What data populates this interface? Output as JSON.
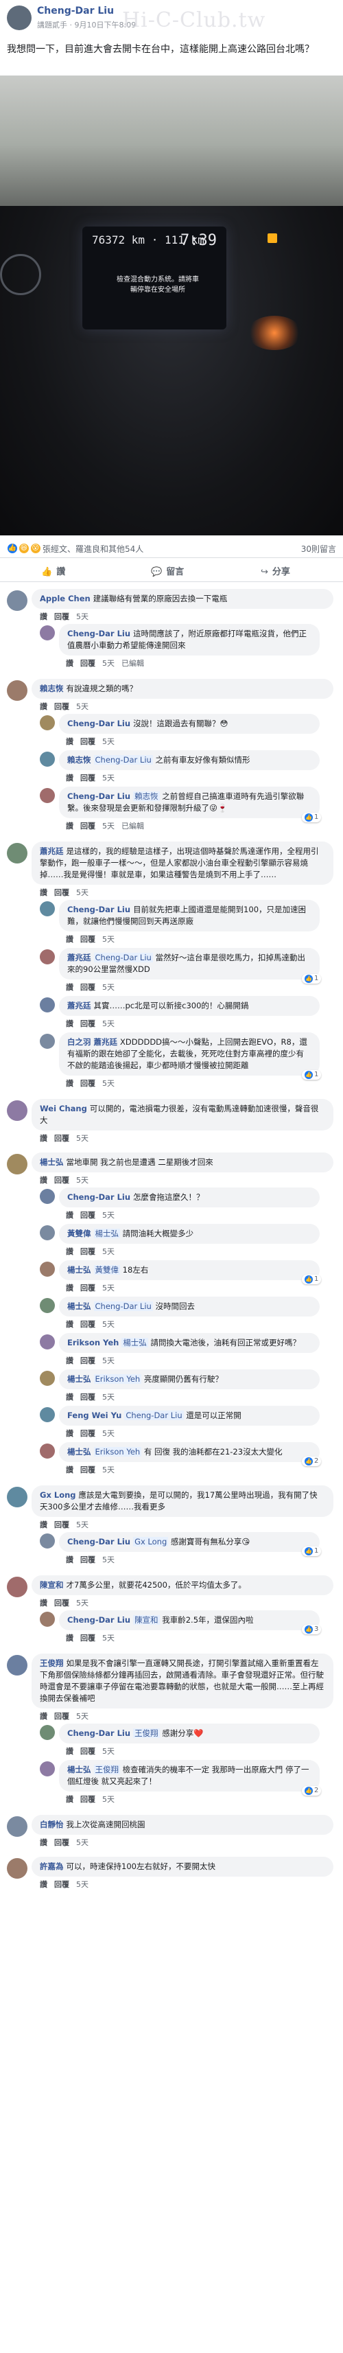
{
  "post": {
    "author": "Cheng-Dar Liu",
    "meta": "講題貳手 · 9月10日下午8:09",
    "watermark": "Hi-C-Club.tw",
    "text": "我想問一下，目前進大會去開卡在台中，這樣能開上高速公路回台北嗎？",
    "photo": {
      "odometer": "76372 km · 111 km",
      "clock": "7:39",
      "warning": "檢查混合動力系統。請將車輛停靠在安全場所"
    }
  },
  "reactions": {
    "summary": "張經文、羅進良和其他54人",
    "comments": "30則留言"
  },
  "actions": {
    "like": "讚",
    "comment": "留言",
    "share": "分享"
  },
  "comments": [
    {
      "name": "Apple Chen",
      "text": "建議聯絡有營業的原廠因去換一下電瓶",
      "links": [
        "讚",
        "回覆",
        "5天"
      ],
      "replies": [
        {
          "name": "Cheng-Dar Liu",
          "text": "這時間應該了，附近原廠都打咩電瓶沒貨，他們正值農曆小車動力希望能傳達開回來",
          "links": [
            "讚",
            "回覆",
            "5天",
            "已編輯"
          ]
        }
      ]
    },
    {
      "name": "賴志恢",
      "text": "有說違規之類的嗎？",
      "links": [
        "讚",
        "回覆",
        "5天"
      ],
      "replies": [
        {
          "name": "Cheng-Dar Liu",
          "text": "沒說！這跟過去有關聯？😳",
          "links": [
            "讚",
            "回覆",
            "5天"
          ]
        },
        {
          "name": "賴志恢",
          "tag": "Cheng-Dar Liu",
          "text": "之前有車友好像有類似情形",
          "links": [
            "讚",
            "回覆",
            "5天"
          ]
        },
        {
          "name": "Cheng-Dar Liu",
          "tag": "賴志恢",
          "text": "之前曾經自己搞進車道時有先過引擎欲聯繫。後來發現是会更新和發揮限制升級了😜🍷",
          "links": [
            "讚",
            "回覆",
            "5天",
            "已編輯"
          ],
          "badge": "1"
        }
      ]
    },
    {
      "name": "蕭兆廷",
      "text": "是這樣的，我的經驗是這樣子，出現這個時基聲於馬達運作用，全程用引擎動作，跑一般車子一樣～～，但是人家都說小油台車全程動引擎顯示容易燒掉……我是覺得慢！車就是車，如果這種警告是燒到不用上手了……",
      "links": [
        "讚",
        "回覆",
        "5天"
      ],
      "replies": [
        {
          "name": "Cheng-Dar Liu",
          "text": "目前就先把車上國道還是能開到100，只是加速困難，就讓他們慢慢開回到天再送原廠",
          "links": [
            "讚",
            "回覆",
            "5天"
          ]
        },
        {
          "name": "蕭兆廷",
          "tag": "Cheng-Dar Liu",
          "text": "當然好～這台車是很吃馬力，扣掉馬達動出來的90公里當然慢XDD",
          "links": [
            "讚",
            "回覆",
            "5天"
          ],
          "badge": "1"
        },
        {
          "name": "蕭兆廷",
          "text": "其實……pc北是可以新接c300的！心腸開鍋",
          "links": [
            "讚",
            "回覆",
            "5天"
          ]
        },
        {
          "name": "白之羽 蕭兆廷",
          "text": "XDDDDDD搞～～小聲點，上回開去跑EVO，R8，還有福斯的跟在她卻了全能化，去載後，死死吃住對方車高裡的度少有不啟的能踏追後揚起，車少都時順才慢慢被拉開距離",
          "links": [
            "讚",
            "回覆",
            "5天"
          ],
          "badge": "1"
        }
      ]
    },
    {
      "name": "Wei Chang",
      "text": "可以開的，電池損電力很差，沒有電動馬達轉動加速很慢，聲音很大",
      "links": [
        "讚",
        "回覆",
        "5天"
      ],
      "replies": []
    },
    {
      "name": "楊士弘",
      "text": "當地車開 我之前也是遭遇 二星期後才回來",
      "links": [
        "讚",
        "回覆",
        "5天"
      ],
      "replies": [
        {
          "name": "Cheng-Dar Liu",
          "text": "怎麼會拖這麼久！？",
          "links": [
            "讚",
            "回覆",
            "5天"
          ]
        },
        {
          "name": "黃雙偉",
          "tag": "楊士弘",
          "text": "請問油耗大概變多少",
          "links": [
            "讚",
            "回覆",
            "5天"
          ]
        },
        {
          "name": "楊士弘",
          "tag": "黃雙偉",
          "text": "18左右",
          "links": [
            "讚",
            "回覆",
            "5天"
          ],
          "badge": "1"
        },
        {
          "name": "楊士弘",
          "tag": "Cheng-Dar Liu",
          "text": "沒時間回去",
          "links": [
            "讚",
            "回覆",
            "5天"
          ]
        },
        {
          "name": "Erikson Yeh",
          "tag": "楊士弘",
          "text": "請問換大電池後，油耗有回正常或更好嗎？",
          "links": [
            "讚",
            "回覆",
            "5天"
          ]
        },
        {
          "name": "楊士弘",
          "tag": "Erikson Yeh",
          "text": "亮度顯開仍舊有行駛？",
          "links": [
            "讚",
            "回覆",
            "5天"
          ]
        },
        {
          "name": "Feng Wei Yu",
          "tag": "Cheng-Dar Liu",
          "text": "還是可以正常開",
          "links": [
            "讚",
            "回覆",
            "5天"
          ]
        },
        {
          "name": "楊士弘",
          "tag": "Erikson Yeh",
          "text": "有 回復 我的油耗都在21-23沒太大變化",
          "links": [
            "讚",
            "回覆",
            "5天"
          ],
          "badge": "2"
        }
      ]
    },
    {
      "name": "Gx Long",
      "text": "應該是大電到要換，是可以開的，我17萬公里時出現過，我有開了快天300多公里才去維修……我看更多",
      "links": [
        "讚",
        "回覆",
        "5天"
      ],
      "replies": [
        {
          "name": "Cheng-Dar Liu",
          "tag": "Gx Long",
          "text": "感謝寶哥有無私分享😘",
          "links": [
            "讚",
            "回覆",
            "5天"
          ],
          "badge": "1"
        }
      ]
    },
    {
      "name": "陳宣和",
      "text": "才7萬多公里，就要花42500，低於平均值太多了。",
      "links": [
        "讚",
        "回覆",
        "5天"
      ],
      "replies": [
        {
          "name": "Cheng-Dar Liu",
          "tag": "陳宣和",
          "text": "我車齡2.5年，還保固內啦",
          "links": [
            "讚",
            "回覆",
            "5天"
          ],
          "badge": "3"
        }
      ]
    },
    {
      "name": "王俊翔",
      "text": "如果是我不會讓引擎一直運轉又開長途，打開引擎蓋試縮入重新重置看左下角那個保險絲條都分鐘再插回去，啟開通看清除。車子會發現還好正常。但行駛時還會是不要讓車子停留在電池要靠轉動的狀態，也就是大電一般開……至上再經換開去保養補吧",
      "links": [
        "讚",
        "回覆",
        "5天"
      ],
      "replies": [
        {
          "name": "Cheng-Dar Liu",
          "tag": "王俊翔",
          "text": "感謝分享❤️",
          "links": [
            "讚",
            "回覆",
            "5天"
          ]
        },
        {
          "name": "楊士弘",
          "tag": "王俊翔",
          "text": "檢查確消失的機率不一定 我那時一出原廠大門 停了一個紅燈後 就又亮起來了！",
          "links": [
            "讚",
            "回覆",
            "5天"
          ],
          "badge": "2"
        }
      ]
    },
    {
      "name": "白靜怡",
      "text": "我上次從高速開回桃園",
      "links": [
        "讚",
        "回覆",
        "5天"
      ],
      "replies": []
    },
    {
      "name": "許嘉為",
      "text": "可以，時速保持100左右就好，不要開太快",
      "links": [
        "讚",
        "回覆",
        "5天"
      ],
      "replies": []
    }
  ],
  "colors": {
    "link": "#385898",
    "bubble": "#f2f3f5",
    "like": "#1877f2"
  }
}
